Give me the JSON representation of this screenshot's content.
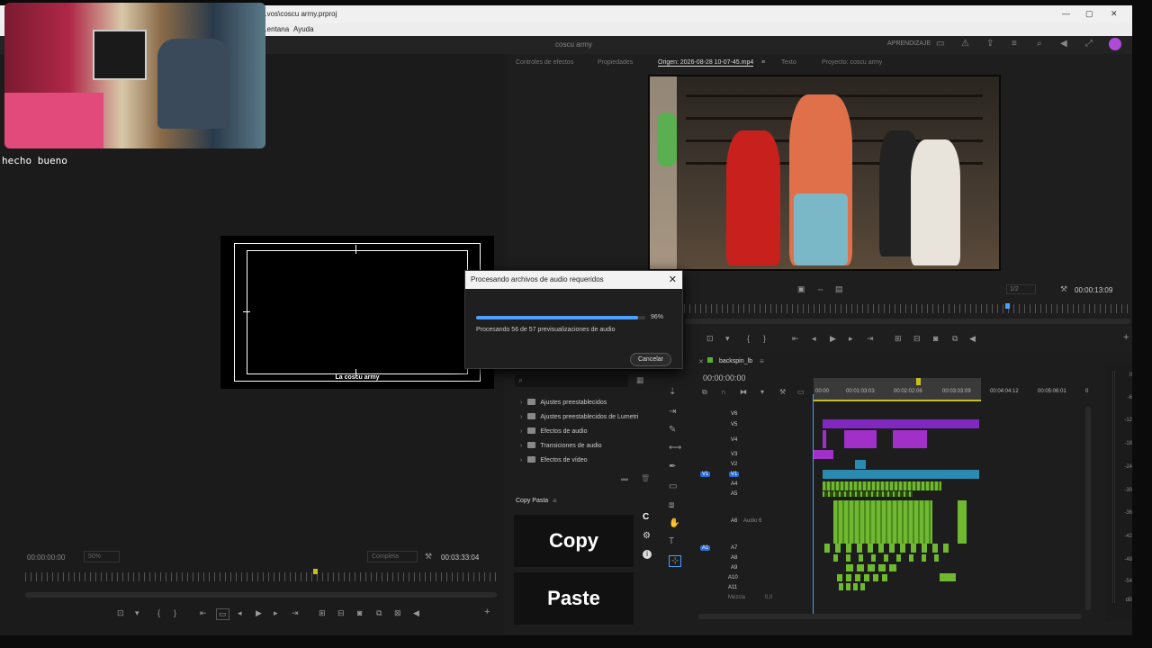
{
  "window": {
    "title": "...vos\\coscu army.prproj",
    "controls": [
      "—",
      "▢",
      "✕"
    ]
  },
  "menu": {
    "items": [
      "...entana",
      "Ayuda"
    ]
  },
  "appbar": {
    "project_name": "coscu army",
    "workspace_label": "APRENDIZAJE"
  },
  "webcam_overlay": {
    "chat_message": "hecho bueno"
  },
  "source_panel": {
    "tabs": [
      "Controles de efectos",
      "Propiedades",
      "Origen: 2026-08-28 10-07-45.mp4",
      "Texto",
      "Proyecto: coscu army"
    ],
    "active_tab": "Origen: 2026-08-28 10-07-45.mp4",
    "zoom": "1/2",
    "timecode": "00:00:13:09"
  },
  "program_monitor": {
    "timecode_left": "00:00:00:00",
    "zoom": "50%",
    "quality": "Completa",
    "timecode_right": "00:03:33:04",
    "caption": "La coscu army"
  },
  "dialog": {
    "title": "Procesando archivos de audio requeridos",
    "progress": 0.96,
    "progress_label": "96%",
    "message": "Procesando 56 de 57 previsualizaciones de audio",
    "cancel_label": "Cancelar"
  },
  "effects_panel": {
    "items": [
      "Ajustes preestablecidos",
      "Ajustes preestablecidos de Lumetri",
      "Efectos de audio",
      "Transiciones de audio",
      "Efectos de vídeo"
    ]
  },
  "copy_pasta": {
    "panel_title": "Copy Pasta",
    "copy_label": "Copy",
    "paste_label": "Paste",
    "side_icons": [
      "C",
      "⚙",
      "i"
    ]
  },
  "timeline": {
    "sequence_name": "backspin_lb",
    "timecode": "00:00:00:00",
    "ruler_marks": [
      "00:00",
      "00:01:03:03",
      "00:02:02:06",
      "00:03:03:09",
      "00:04:04:12",
      "00:05:06:01",
      "0"
    ],
    "video_tracks": [
      "V6",
      "V5",
      "V4",
      "V3",
      "V2",
      "V1"
    ],
    "audio_tracks": [
      "A4",
      "A5",
      "A6",
      "A7",
      "A8",
      "A9",
      "A10",
      "A11"
    ],
    "audio6_name": "Audio 6",
    "mix_label": "Mezcla",
    "mix_value": "0,0",
    "source_patch_v": "V1",
    "source_patch_a": "A1"
  },
  "meters": {
    "scale": [
      "0",
      "-6",
      "-12",
      "-18",
      "-24",
      "-30",
      "-36",
      "-42",
      "-48",
      "-54",
      "dB"
    ]
  },
  "colors": {
    "panel_bg": "#1d1d1d",
    "accent_blue": "#2c6cd3",
    "clip_purple": "#a030c8",
    "clip_teal": "#2a8ab0",
    "clip_green": "#6fb830",
    "progress_blue": "#4a9fff"
  }
}
